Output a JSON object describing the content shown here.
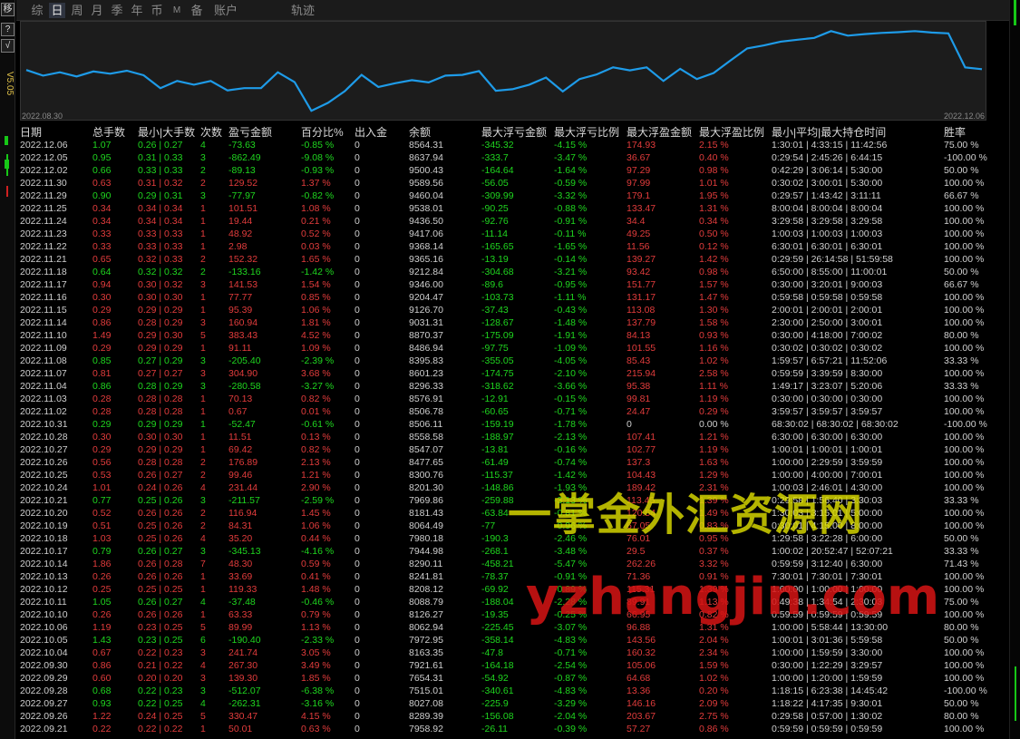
{
  "toolbar": {
    "top_button": "移",
    "help_button": "?",
    "check_button": "√",
    "version": "V5.05"
  },
  "tabs": [
    "综",
    "日",
    "周",
    "月",
    "季",
    "年",
    "币",
    "M",
    "备",
    "账户",
    "轨迹"
  ],
  "active_tab": "日",
  "chart": {
    "start_date": "2022.08.30",
    "end_date": "2022.12.06",
    "line_color": "#1e9be8",
    "line_values": [
      8620,
      8470,
      8560,
      8450,
      8580,
      8520,
      8600,
      8480,
      8140,
      8330,
      8230,
      8330,
      8080,
      8140,
      8140,
      8560,
      8300,
      7540,
      7750,
      8060,
      8490,
      8170,
      8270,
      8350,
      8290,
      8470,
      8490,
      8590,
      8070,
      8110,
      8230,
      8420,
      8050,
      8380,
      8500,
      8690,
      8610,
      8690,
      8330,
      8650,
      8380,
      8540,
      8870,
      9190,
      9270,
      9370,
      9420,
      9470,
      9650,
      9530,
      9570,
      9600,
      9620,
      9650,
      9610,
      9590,
      8690,
      8640
    ],
    "y_min": 7400,
    "y_max": 9800
  },
  "headers": [
    "日期",
    "总手数",
    "最小|大手数",
    "次数",
    "盈亏金额",
    "百分比%",
    "出入金",
    "余额",
    "最大浮亏金额",
    "最大浮亏比例",
    "最大浮盈金额",
    "最大浮盈比例",
    "最小|平均|最大持仓时间",
    "胜率"
  ],
  "rows": [
    [
      "2022.12.06",
      "1.07",
      "0.26 | 0.27",
      "4",
      "-73.63",
      "-0.85 %",
      "0",
      "8564.31",
      "-345.32",
      "-4.15 %",
      "174.93",
      "2.15 %",
      "1:30:01 | 4:33:15 | 11:42:56",
      "75.00 %"
    ],
    [
      "2022.12.05",
      "0.95",
      "0.31 | 0.33",
      "3",
      "-862.49",
      "-9.08 %",
      "0",
      "8637.94",
      "-333.7",
      "-3.47 %",
      "36.67",
      "0.40 %",
      "0:29:54 | 2:45:26 | 6:44:15",
      "-100.00 %"
    ],
    [
      "2022.12.02",
      "0.66",
      "0.33 | 0.33",
      "2",
      "-89.13",
      "-0.93 %",
      "0",
      "9500.43",
      "-164.64",
      "-1.64 %",
      "97.29",
      "0.98 %",
      "0:42:29 | 3:06:14 | 5:30:00",
      "50.00 %"
    ],
    [
      "2022.11.30",
      "0.63",
      "0.31 | 0.32",
      "2",
      "129.52",
      "1.37 %",
      "0",
      "9589.56",
      "-56.05",
      "-0.59 %",
      "97.99",
      "1.01 %",
      "0:30:02 | 3:00:01 | 5:30:00",
      "100.00 %"
    ],
    [
      "2022.11.29",
      "0.90",
      "0.29 | 0.31",
      "3",
      "-77.97",
      "-0.82 %",
      "0",
      "9460.04",
      "-309.99",
      "-3.32 %",
      "179.1",
      "1.95 %",
      "0:29:57 | 1:43:42 | 3:11:11",
      "66.67 %"
    ],
    [
      "2022.11.25",
      "0.34",
      "0.34 | 0.34",
      "1",
      "101.51",
      "1.08 %",
      "0",
      "9538.01",
      "-90.25",
      "-0.88 %",
      "133.47",
      "1.31 %",
      "8:00:04 | 8:00:04 | 8:00:04",
      "100.00 %"
    ],
    [
      "2022.11.24",
      "0.34",
      "0.34 | 0.34",
      "1",
      "19.44",
      "0.21 %",
      "0",
      "9436.50",
      "-92.76",
      "-0.91 %",
      "34.4",
      "0.34 %",
      "3:29:58 | 3:29:58 | 3:29:58",
      "100.00 %"
    ],
    [
      "2022.11.23",
      "0.33",
      "0.33 | 0.33",
      "1",
      "48.92",
      "0.52 %",
      "0",
      "9417.06",
      "-11.14",
      "-0.11 %",
      "49.25",
      "0.50 %",
      "1:00:03 | 1:00:03 | 1:00:03",
      "100.00 %"
    ],
    [
      "2022.11.22",
      "0.33",
      "0.33 | 0.33",
      "1",
      "2.98",
      "0.03 %",
      "0",
      "9368.14",
      "-165.65",
      "-1.65 %",
      "11.56",
      "0.12 %",
      "6:30:01 | 6:30:01 | 6:30:01",
      "100.00 %"
    ],
    [
      "2022.11.21",
      "0.65",
      "0.32 | 0.33",
      "2",
      "152.32",
      "1.65 %",
      "0",
      "9365.16",
      "-13.19",
      "-0.14 %",
      "139.27",
      "1.42 %",
      "0:29:59 | 26:14:58 | 51:59:58",
      "100.00 %"
    ],
    [
      "2022.11.18",
      "0.64",
      "0.32 | 0.32",
      "2",
      "-133.16",
      "-1.42 %",
      "0",
      "9212.84",
      "-304.68",
      "-3.21 %",
      "93.42",
      "0.98 %",
      "6:50:00 | 8:55:00 | 11:00:01",
      "50.00 %"
    ],
    [
      "2022.11.17",
      "0.94",
      "0.30 | 0.32",
      "3",
      "141.53",
      "1.54 %",
      "0",
      "9346.00",
      "-89.6",
      "-0.95 %",
      "151.77",
      "1.57 %",
      "0:30:00 | 3:20:01 | 9:00:03",
      "66.67 %"
    ],
    [
      "2022.11.16",
      "0.30",
      "0.30 | 0.30",
      "1",
      "77.77",
      "0.85 %",
      "0",
      "9204.47",
      "-103.73",
      "-1.11 %",
      "131.17",
      "1.47 %",
      "0:59:58 | 0:59:58 | 0:59:58",
      "100.00 %"
    ],
    [
      "2022.11.15",
      "0.29",
      "0.29 | 0.29",
      "1",
      "95.39",
      "1.06 %",
      "0",
      "9126.70",
      "-37.43",
      "-0.43 %",
      "113.08",
      "1.30 %",
      "2:00:01 | 2:00:01 | 2:00:01",
      "100.00 %"
    ],
    [
      "2022.11.14",
      "0.86",
      "0.28 | 0.29",
      "3",
      "160.94",
      "1.81 %",
      "0",
      "9031.31",
      "-128.67",
      "-1.48 %",
      "137.79",
      "1.58 %",
      "2:30:00 | 2:50:00 | 3:00:01",
      "100.00 %"
    ],
    [
      "2022.11.10",
      "1.49",
      "0.29 | 0.30",
      "5",
      "383.43",
      "4.52 %",
      "0",
      "8870.37",
      "-175.09",
      "-1.91 %",
      "84.13",
      "0.93 %",
      "0:30:00 | 4:18:00 | 7:00:02",
      "80.00 %"
    ],
    [
      "2022.11.09",
      "0.29",
      "0.29 | 0.29",
      "1",
      "91.11",
      "1.09 %",
      "0",
      "8486.94",
      "-97.75",
      "-1.09 %",
      "101.55",
      "1.16 %",
      "0:30:02 | 0:30:02 | 0:30:02",
      "100.00 %"
    ],
    [
      "2022.11.08",
      "0.85",
      "0.27 | 0.29",
      "3",
      "-205.40",
      "-2.39 %",
      "0",
      "8395.83",
      "-355.05",
      "-4.05 %",
      "85.43",
      "1.02 %",
      "1:59:57 | 6:57:21 | 11:52:06",
      "33.33 %"
    ],
    [
      "2022.11.07",
      "0.81",
      "0.27 | 0.27",
      "3",
      "304.90",
      "3.68 %",
      "0",
      "8601.23",
      "-174.75",
      "-2.10 %",
      "215.94",
      "2.58 %",
      "0:59:59 | 3:39:59 | 8:30:00",
      "100.00 %"
    ],
    [
      "2022.11.04",
      "0.86",
      "0.28 | 0.29",
      "3",
      "-280.58",
      "-3.27 %",
      "0",
      "8296.33",
      "-318.62",
      "-3.66 %",
      "95.38",
      "1.11 %",
      "1:49:17 | 3:23:07 | 5:20:06",
      "33.33 %"
    ],
    [
      "2022.11.03",
      "0.28",
      "0.28 | 0.28",
      "1",
      "70.13",
      "0.82 %",
      "0",
      "8576.91",
      "-12.91",
      "-0.15 %",
      "99.81",
      "1.19 %",
      "0:30:00 | 0:30:00 | 0:30:00",
      "100.00 %"
    ],
    [
      "2022.11.02",
      "0.28",
      "0.28 | 0.28",
      "1",
      "0.67",
      "0.01 %",
      "0",
      "8506.78",
      "-60.65",
      "-0.71 %",
      "24.47",
      "0.29 %",
      "3:59:57 | 3:59:57 | 3:59:57",
      "100.00 %"
    ],
    [
      "2022.10.31",
      "0.29",
      "0.29 | 0.29",
      "1",
      "-52.47",
      "-0.61 %",
      "0",
      "8506.11",
      "-159.19",
      "-1.78 %",
      "0",
      "0.00 %",
      "68:30:02 | 68:30:02 | 68:30:02",
      "-100.00 %"
    ],
    [
      "2022.10.28",
      "0.30",
      "0.30 | 0.30",
      "1",
      "11.51",
      "0.13 %",
      "0",
      "8558.58",
      "-188.97",
      "-2.13 %",
      "107.41",
      "1.21 %",
      "6:30:00 | 6:30:00 | 6:30:00",
      "100.00 %"
    ],
    [
      "2022.10.27",
      "0.29",
      "0.29 | 0.29",
      "1",
      "69.42",
      "0.82 %",
      "0",
      "8547.07",
      "-13.81",
      "-0.16 %",
      "102.77",
      "1.19 %",
      "1:00:01 | 1:00:01 | 1:00:01",
      "100.00 %"
    ],
    [
      "2022.10.26",
      "0.56",
      "0.28 | 0.28",
      "2",
      "176.89",
      "2.13 %",
      "0",
      "8477.65",
      "-61.49",
      "-0.74 %",
      "137.3",
      "1.63 %",
      "1:00:00 | 2:29:59 | 3:59:59",
      "100.00 %"
    ],
    [
      "2022.10.25",
      "0.53",
      "0.26 | 0.27",
      "2",
      "99.46",
      "1.21 %",
      "0",
      "8300.76",
      "-115.37",
      "-1.42 %",
      "104.43",
      "1.29 %",
      "1:00:00 | 4:00:00 | 7:00:01",
      "100.00 %"
    ],
    [
      "2022.10.24",
      "1.01",
      "0.24 | 0.26",
      "4",
      "231.44",
      "2.90 %",
      "0",
      "8201.30",
      "-148.86",
      "-1.93 %",
      "189.42",
      "2.31 %",
      "1:00:03 | 2:46:01 | 4:30:00",
      "100.00 %"
    ],
    [
      "2022.10.21",
      "0.77",
      "0.25 | 0.26",
      "3",
      "-211.57",
      "-2.59 %",
      "0",
      "7969.86",
      "-259.88",
      "-3.13 %",
      "113.45",
      "1.39 %",
      "0:29:58 | 1:56:40 | 3:30:03",
      "33.33 %"
    ],
    [
      "2022.10.20",
      "0.52",
      "0.26 | 0.26",
      "2",
      "116.94",
      "1.45 %",
      "0",
      "8181.43",
      "-63.84",
      "-0.81 %",
      "120.54",
      "1.49 %",
      "1:30:03 | 3:15:01 | 5:00:00",
      "100.00 %"
    ],
    [
      "2022.10.19",
      "0.51",
      "0.25 | 0.26",
      "2",
      "84.31",
      "1.06 %",
      "0",
      "8064.49",
      "-77",
      "-0.96 %",
      "67.05",
      "0.83 %",
      "0:30:01 | 4:15:00 | 8:00:00",
      "100.00 %"
    ],
    [
      "2022.10.18",
      "1.03",
      "0.25 | 0.26",
      "4",
      "35.20",
      "0.44 %",
      "0",
      "7980.18",
      "-190.3",
      "-2.46 %",
      "76.01",
      "0.95 %",
      "1:29:58 | 3:22:28 | 6:00:00",
      "50.00 %"
    ],
    [
      "2022.10.17",
      "0.79",
      "0.26 | 0.27",
      "3",
      "-345.13",
      "-4.16 %",
      "0",
      "7944.98",
      "-268.1",
      "-3.48 %",
      "29.5",
      "0.37 %",
      "1:00:02 | 20:52:47 | 52:07:21",
      "33.33 %"
    ],
    [
      "2022.10.14",
      "1.86",
      "0.26 | 0.28",
      "7",
      "48.30",
      "0.59 %",
      "0",
      "8290.11",
      "-458.21",
      "-5.47 %",
      "262.26",
      "3.32 %",
      "0:59:59 | 3:12:40 | 6:30:00",
      "71.43 %"
    ],
    [
      "2022.10.13",
      "0.26",
      "0.26 | 0.26",
      "1",
      "33.69",
      "0.41 %",
      "0",
      "8241.81",
      "-78.37",
      "-0.91 %",
      "71.36",
      "0.91 %",
      "7:30:01 | 7:30:01 | 7:30:01",
      "100.00 %"
    ],
    [
      "2022.10.12",
      "0.25",
      "0.25 | 0.25",
      "1",
      "119.33",
      "1.48 %",
      "0",
      "8208.12",
      "-69.92",
      "-0.89 %",
      "115.31",
      "1.39 %",
      "1:00:00 | 1:00:00 | 1:00:00",
      "100.00 %"
    ],
    [
      "2022.10.11",
      "1.05",
      "0.26 | 0.27",
      "4",
      "-37.48",
      "-0.46 %",
      "0",
      "8088.79",
      "-188.04",
      "-2.28 %",
      "89.91",
      "1.13 %",
      "0:49:38 | 1:34:54 | 2:30:03",
      "75.00 %"
    ],
    [
      "2022.10.10",
      "0.26",
      "0.26 | 0.26",
      "1",
      "63.33",
      "0.79 %",
      "0",
      "8126.27",
      "-19.35",
      "-0.25 %",
      "66.95",
      "0.82 %",
      "0:59:59 | 0:59:59 | 0:59:59",
      "100.00 %"
    ],
    [
      "2022.10.06",
      "1.19",
      "0.23 | 0.25",
      "5",
      "89.99",
      "1.13 %",
      "0",
      "8062.94",
      "-225.45",
      "-3.07 %",
      "96.88",
      "1.31 %",
      "1:00:00 | 5:58:44 | 13:30:00",
      "80.00 %"
    ],
    [
      "2022.10.05",
      "1.43",
      "0.23 | 0.25",
      "6",
      "-190.40",
      "-2.33 %",
      "0",
      "7972.95",
      "-358.14",
      "-4.83 %",
      "143.56",
      "2.04 %",
      "1:00:01 | 3:01:36 | 5:59:58",
      "50.00 %"
    ],
    [
      "2022.10.04",
      "0.67",
      "0.22 | 0.23",
      "3",
      "241.74",
      "3.05 %",
      "0",
      "8163.35",
      "-47.8",
      "-0.71 %",
      "160.32",
      "2.34 %",
      "1:00:00 | 1:59:59 | 3:30:00",
      "100.00 %"
    ],
    [
      "2022.09.30",
      "0.86",
      "0.21 | 0.22",
      "4",
      "267.30",
      "3.49 %",
      "0",
      "7921.61",
      "-164.18",
      "-2.54 %",
      "105.06",
      "1.59 %",
      "0:30:00 | 1:22:29 | 3:29:57",
      "100.00 %"
    ],
    [
      "2022.09.29",
      "0.60",
      "0.20 | 0.20",
      "3",
      "139.30",
      "1.85 %",
      "0",
      "7654.31",
      "-54.92",
      "-0.87 %",
      "64.68",
      "1.02 %",
      "1:00:00 | 1:20:00 | 1:59:59",
      "100.00 %"
    ],
    [
      "2022.09.28",
      "0.68",
      "0.22 | 0.23",
      "3",
      "-512.07",
      "-6.38 %",
      "0",
      "7515.01",
      "-340.61",
      "-4.83 %",
      "13.36",
      "0.20 %",
      "1:18:15 | 6:23:38 | 14:45:42",
      "-100.00 %"
    ],
    [
      "2022.09.27",
      "0.93",
      "0.22 | 0.25",
      "4",
      "-262.31",
      "-3.16 %",
      "0",
      "8027.08",
      "-225.9",
      "-3.29 %",
      "146.16",
      "2.09 %",
      "1:18:22 | 4:17:35 | 9:30:01",
      "50.00 %"
    ],
    [
      "2022.09.26",
      "1.22",
      "0.24 | 0.25",
      "5",
      "330.47",
      "4.15 %",
      "0",
      "8289.39",
      "-156.08",
      "-2.04 %",
      "203.67",
      "2.75 %",
      "0:29:58 | 0:57:00 | 1:30:02",
      "80.00 %"
    ],
    [
      "2022.09.21",
      "0.22",
      "0.22 | 0.22",
      "1",
      "50.01",
      "0.63 %",
      "0",
      "7958.92",
      "-26.11",
      "-0.39 %",
      "57.27",
      "0.86 %",
      "0:59:59 | 0:59:59 | 0:59:59",
      "100.00 %"
    ]
  ],
  "watermark": {
    "line1": "一掌金外汇资源网",
    "line2": "yzhangjin.com"
  }
}
